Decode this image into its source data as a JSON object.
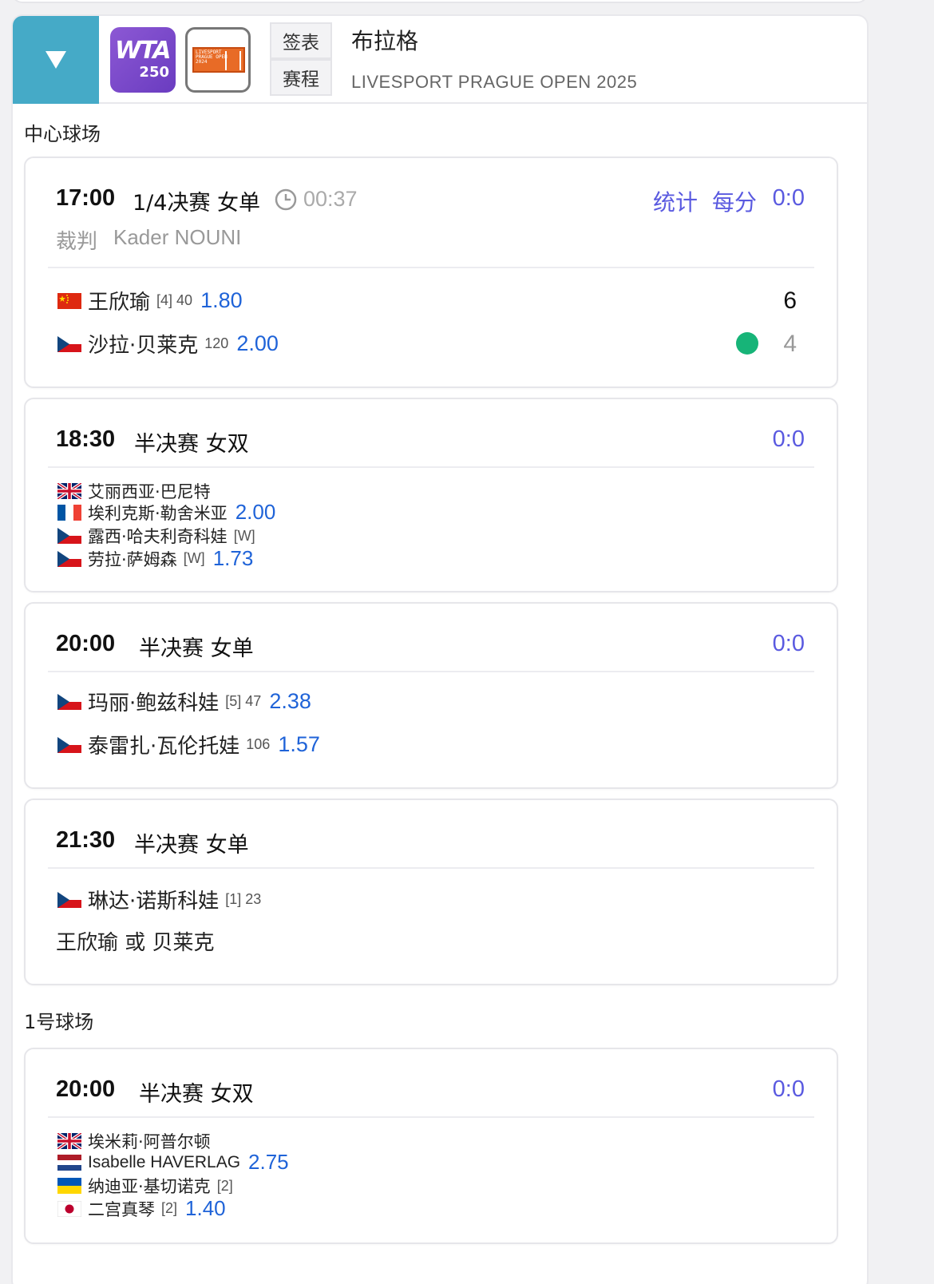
{
  "header": {
    "collapse_icon": "triangle-down-icon",
    "wta_logo": {
      "line1": "WTA",
      "line2": "250"
    },
    "event_logo": {
      "text": "LIVESPORT\nPRAGUE OPEN\n2024"
    },
    "btn_draw": "签表",
    "btn_schedule": "赛程",
    "city": "布拉格",
    "tournament": "LIVESPORT PRAGUE OPEN 2025"
  },
  "courts": [
    {
      "label": "中心球场",
      "matches": [
        {
          "time": "17:00",
          "round": "1/4决赛 女单",
          "elapsed": "00:37",
          "stats": "统计",
          "per_point": "每分",
          "score": "0:0",
          "umpire_label": "裁判",
          "umpire": "Kader NOUNI",
          "players": [
            {
              "flag": "cn",
              "name": "王欣瑜",
              "meta": "[4] 40",
              "odds": "1.80",
              "set": "6"
            },
            {
              "flag": "cz",
              "name": "沙拉·贝莱克",
              "meta": "120",
              "odds": "2.00",
              "set": "4",
              "serving": true
            }
          ]
        },
        {
          "time": "18:30",
          "round": "半决赛 女双",
          "score": "0:0",
          "players": [
            {
              "flag": "gb",
              "name": "艾丽西亚·巴尼特",
              "meta": "",
              "odds": ""
            },
            {
              "flag": "fr",
              "name": "埃利克斯·勒舍米亚",
              "meta": "",
              "odds": "2.00"
            },
            {
              "flag": "cz",
              "name": "露西·哈夫利奇科娃",
              "meta": "[W]",
              "odds": ""
            },
            {
              "flag": "cz",
              "name": "劳拉·萨姆森",
              "meta": "[W]",
              "odds": "1.73"
            }
          ]
        },
        {
          "time": "20:00",
          "round": "半决赛 女单",
          "score": "0:0",
          "players": [
            {
              "flag": "cz",
              "name": "玛丽·鲍兹科娃",
              "meta": "[5] 47",
              "odds": "2.38"
            },
            {
              "flag": "cz",
              "name": "泰雷扎·瓦伦托娃",
              "meta": "106",
              "odds": "1.57"
            }
          ]
        },
        {
          "time": "21:30",
          "round": "半决赛 女单",
          "score": "",
          "players": [
            {
              "flag": "cz",
              "name": "琳达·诺斯科娃",
              "meta": "[1] 23",
              "odds": ""
            }
          ],
          "opponent_placeholder": "王欣瑜 或 贝莱克"
        }
      ]
    },
    {
      "label": "1号球场",
      "matches": [
        {
          "time": "20:00",
          "round": "半决赛 女双",
          "score": "0:0",
          "players": [
            {
              "flag": "gb",
              "name": "埃米莉·阿普尔顿",
              "meta": "",
              "odds": ""
            },
            {
              "flag": "nl",
              "name": "Isabelle HAVERLAG",
              "meta": "",
              "odds": "2.75"
            },
            {
              "flag": "ua",
              "name": "纳迪亚·基切诺克",
              "meta": "[2]",
              "odds": ""
            },
            {
              "flag": "jp",
              "name": "二宫真琴",
              "meta": "[2]",
              "odds": "1.40"
            }
          ]
        }
      ]
    }
  ],
  "colors": {
    "accent_blue": "#45aac7",
    "score_purple": "#5a5ae0",
    "odds_blue": "#1f63d8",
    "serve_green": "#17b478"
  }
}
